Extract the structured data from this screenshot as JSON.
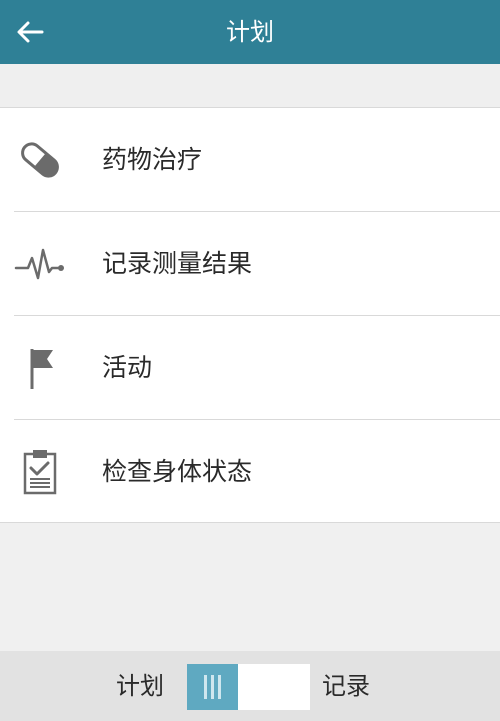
{
  "header": {
    "title": "计划"
  },
  "menu": {
    "items": [
      {
        "label": "药物治疗",
        "icon": "pill-icon"
      },
      {
        "label": "记录测量结果",
        "icon": "heartbeat-icon"
      },
      {
        "label": "活动",
        "icon": "flag-icon"
      },
      {
        "label": "检查身体状态",
        "icon": "clipboard-check-icon"
      }
    ]
  },
  "bottom_bar": {
    "left_label": "计划",
    "right_label": "记录"
  },
  "colors": {
    "header_bg": "#2f8096",
    "toggle_knob": "#5fa9c1",
    "icon_gray": "#6b6b6b"
  }
}
